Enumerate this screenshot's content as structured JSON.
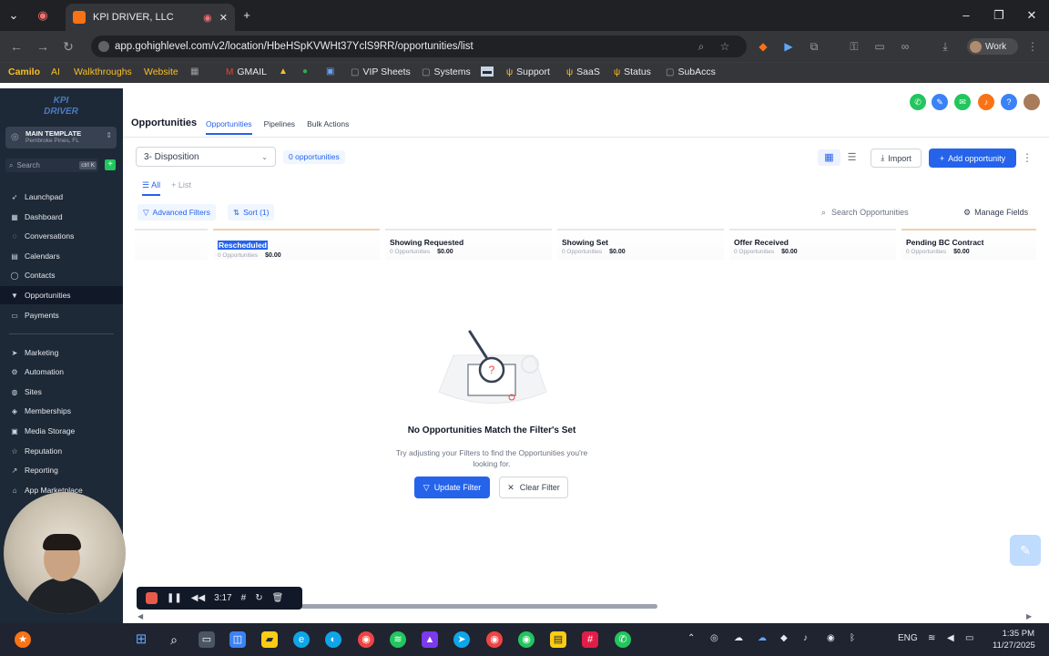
{
  "browser": {
    "tab_title": "KPI DRIVER, LLC",
    "url": "app.gohighlevel.com/v2/location/HbeHSpKVWHt37YclS9RR/opportunities/list",
    "profile_label": "Work",
    "bookmarks": [
      "Camilo",
      "AI",
      "Walkthroughs",
      "Website",
      "GMAIL",
      "VIP Sheets",
      "Systems",
      "Support",
      "SaaS",
      "Status",
      "SubAccs"
    ]
  },
  "sidebar": {
    "logo_line1": "KPI",
    "logo_line2": "DRIVER",
    "location_name": "MAIN TEMPLATE",
    "location_city": "Pembroke Pines, FL",
    "search_placeholder": "Search",
    "search_shortcut": "ctrl K",
    "items": [
      {
        "label": "Launchpad",
        "icon": "rocket-icon"
      },
      {
        "label": "Dashboard",
        "icon": "grid-icon"
      },
      {
        "label": "Conversations",
        "icon": "chat-icon"
      },
      {
        "label": "Calendars",
        "icon": "calendar-icon"
      },
      {
        "label": "Contacts",
        "icon": "user-icon"
      },
      {
        "label": "Opportunities",
        "icon": "funnel-icon",
        "active": true
      },
      {
        "label": "Payments",
        "icon": "card-icon"
      },
      {
        "label": "Marketing",
        "icon": "send-icon"
      },
      {
        "label": "Automation",
        "icon": "cog-icon"
      },
      {
        "label": "Sites",
        "icon": "globe-icon"
      },
      {
        "label": "Memberships",
        "icon": "badge-icon"
      },
      {
        "label": "Media Storage",
        "icon": "folder-icon"
      },
      {
        "label": "Reputation",
        "icon": "star-icon"
      },
      {
        "label": "Reporting",
        "icon": "chart-icon"
      },
      {
        "label": "App Marketplace",
        "icon": "store-icon"
      }
    ]
  },
  "header": {
    "title": "Opportunities",
    "tabs": [
      "Opportunities",
      "Pipelines",
      "Bulk Actions"
    ]
  },
  "toolbar": {
    "pipeline": "3- Disposition",
    "count": "0 opportunities",
    "import_label": "Import",
    "add_label": "Add opportunity",
    "tab_all": "All",
    "tab_list": "List",
    "advanced_filters": "Advanced Filters",
    "sort_label": "Sort (1)",
    "search_placeholder": "Search Opportunities",
    "manage_fields": "Manage Fields"
  },
  "stages": [
    {
      "name": "Rescheduled",
      "count": "0 Opportunities",
      "value": "$0.00"
    },
    {
      "name": "Showing Requested",
      "count": "0 Opportunities",
      "value": "$0.00"
    },
    {
      "name": "Showing Set",
      "count": "0 Opportunities",
      "value": "$0.00"
    },
    {
      "name": "Offer Received",
      "count": "0 Opportunities",
      "value": "$0.00"
    },
    {
      "name": "Pending BC Contract",
      "count": "0 Opportunities",
      "value": "$0.00"
    }
  ],
  "empty_state": {
    "title": "No Opportunities Match the Filter's Set",
    "subtitle": "Try adjusting your Filters to find the Opportunities you're looking for.",
    "update_label": "Update Filter",
    "clear_label": "Clear Filter"
  },
  "recorder": {
    "time": "3:17"
  },
  "taskbar": {
    "lang": "ENG",
    "time": "1:35 PM",
    "date": "11/27/2025"
  },
  "colors": {
    "accent": "#2563eb",
    "sidebar_bg": "#1e2937"
  }
}
